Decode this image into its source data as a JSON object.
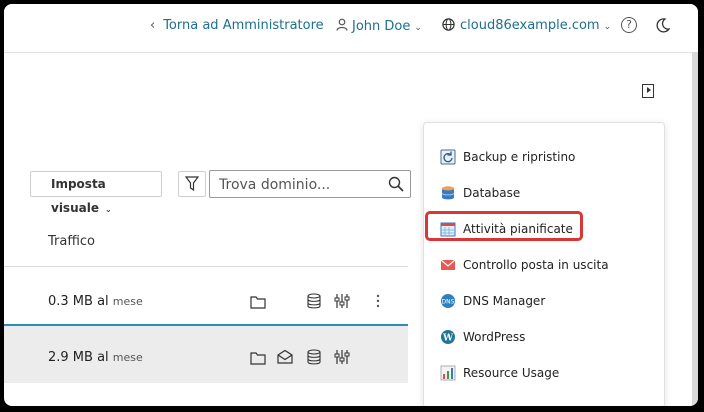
{
  "topbar": {
    "back_label": "Torna ad Amministratore",
    "back_arrow": "‹",
    "user_name": "John Doe",
    "domain_name": "cloud86example.com",
    "caret": "⌄",
    "help_symbol": "?",
    "user_icon": "user-icon",
    "globe_icon": "globe-icon",
    "theme_icon": "moon-icon"
  },
  "toolbar": {
    "view_label": "Imposta visuale",
    "view_caret": "⌄",
    "search_placeholder": "Trova dominio..."
  },
  "table": {
    "column_traffic": "Traffico",
    "rows": [
      {
        "value": "0.3 MB al",
        "unit": "mese",
        "selected": false
      },
      {
        "value": "2.9 MB al",
        "unit": "mese",
        "selected": true
      }
    ]
  },
  "menu": {
    "items": [
      {
        "label": "Backup e ripristino",
        "icon": "backup-icon"
      },
      {
        "label": "Database",
        "icon": "database-icon"
      },
      {
        "label": "Attività pianificate",
        "icon": "calendar-icon",
        "highlighted": true
      },
      {
        "label": "Controllo posta in uscita",
        "icon": "mail-icon"
      },
      {
        "label": "DNS Manager",
        "icon": "dns-icon"
      },
      {
        "label": "WordPress",
        "icon": "wordpress-icon"
      },
      {
        "label": "Resource Usage",
        "icon": "chart-icon"
      }
    ]
  },
  "colors": {
    "link": "#1d6f8e",
    "highlight": "#d93636",
    "selected_row_border": "#2b8fb5"
  }
}
